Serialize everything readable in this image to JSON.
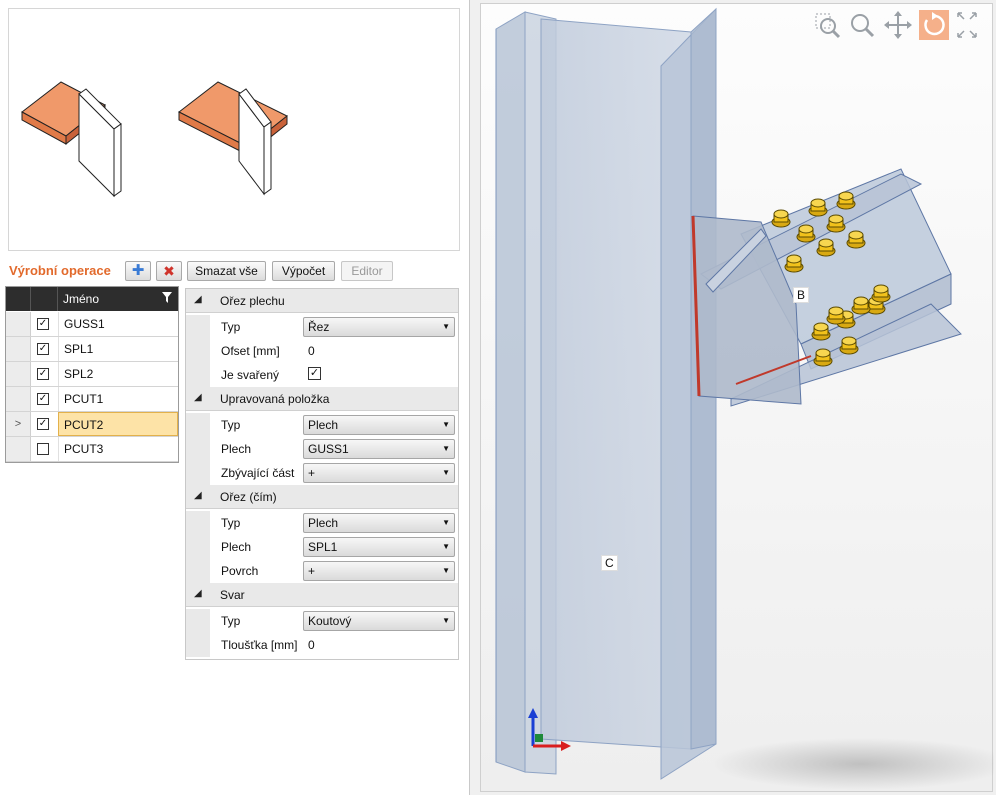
{
  "operations_panel": {
    "title": "Výrobní operace",
    "add_icon": "plus-icon",
    "delete_icon": "delete-x-icon",
    "delete_all_label": "Smazat vše",
    "calculate_label": "Výpočet",
    "editor_label": "Editor"
  },
  "grid": {
    "header_name": "Jméno",
    "filter_icon": "filter-icon",
    "rows": [
      {
        "name": "GUSS1",
        "checked": true,
        "selected": false
      },
      {
        "name": "SPL1",
        "checked": true,
        "selected": false
      },
      {
        "name": "SPL2",
        "checked": true,
        "selected": false
      },
      {
        "name": "PCUT1",
        "checked": true,
        "selected": false
      },
      {
        "name": "PCUT2",
        "checked": true,
        "selected": true,
        "indicator": ">"
      },
      {
        "name": "PCUT3",
        "checked": false,
        "selected": false
      }
    ]
  },
  "properties": {
    "sections": [
      {
        "title": "Ořez plechu",
        "rows": [
          {
            "label": "Typ",
            "kind": "dropdown",
            "value": "Řez"
          },
          {
            "label": "Ofset [mm]",
            "kind": "text",
            "value": "0"
          },
          {
            "label": "Je svařený",
            "kind": "checkbox",
            "value": "✓"
          }
        ]
      },
      {
        "title": "Upravovaná položka",
        "rows": [
          {
            "label": "Typ",
            "kind": "dropdown",
            "value": "Plech"
          },
          {
            "label": "Plech",
            "kind": "dropdown",
            "value": "GUSS1"
          },
          {
            "label": "Zbývající část",
            "kind": "dropdown",
            "value": "+"
          }
        ]
      },
      {
        "title": "Ořez (čím)",
        "rows": [
          {
            "label": "Typ",
            "kind": "dropdown",
            "value": "Plech"
          },
          {
            "label": "Plech",
            "kind": "dropdown",
            "value": "SPL1"
          },
          {
            "label": "Povrch",
            "kind": "dropdown",
            "value": "+"
          }
        ]
      },
      {
        "title": "Svar",
        "rows": [
          {
            "label": "Typ",
            "kind": "dropdown",
            "value": "Koutový"
          },
          {
            "label": "Tloušťka [mm]",
            "kind": "text",
            "value": "0"
          }
        ]
      }
    ]
  },
  "view3d": {
    "tools": [
      "zoom-window-icon",
      "zoom-icon",
      "pan-icon",
      "rotate-icon",
      "fullscreen-icon"
    ],
    "label_b": "B",
    "label_c": "C",
    "colors": {
      "accent": "#e26a2c",
      "steel": "#b9c6d8",
      "bolt": "#f2c21b",
      "weld": "#c0392b",
      "plate": "#f0996a"
    }
  }
}
